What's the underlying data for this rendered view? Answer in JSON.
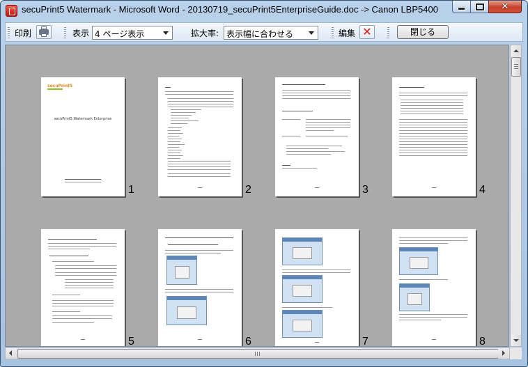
{
  "window": {
    "title": "secuPrint5 Watermark - Microsoft Word - 20130719_secuPrint5EnterpriseGuide.doc -> Canon LBP5400",
    "close_glyph": "✕"
  },
  "toolbar": {
    "print_label": "印刷",
    "view_label": "表示",
    "view_value": "4 ページ表示",
    "zoom_label": "拡大率:",
    "zoom_value": "表示幅に合わせる",
    "edit_label": "編集",
    "close_label": "閉じる"
  },
  "icons": {
    "app": "app-icon",
    "print": "printer-icon",
    "edit": "red-x-icon"
  },
  "pages": [
    {
      "number": "1",
      "cover_logo": "secuPrint5",
      "cover_title": "secuPrint5 Watermark Enterprise"
    },
    {
      "number": "2"
    },
    {
      "number": "3"
    },
    {
      "number": "4"
    },
    {
      "number": "5"
    },
    {
      "number": "6"
    },
    {
      "number": "7"
    },
    {
      "number": "8"
    }
  ],
  "scroll": {
    "vertical_position": 0.0,
    "horizontal_visible_fraction": 1.0
  },
  "colors": {
    "title_bar": "#b9d1ea",
    "viewer_background": "#aaaaaa",
    "close_button": "#c7402a",
    "edit_icon": "#dd1111",
    "logo_green": "#8cbf2a",
    "logo_orange": "#e08a1e"
  }
}
